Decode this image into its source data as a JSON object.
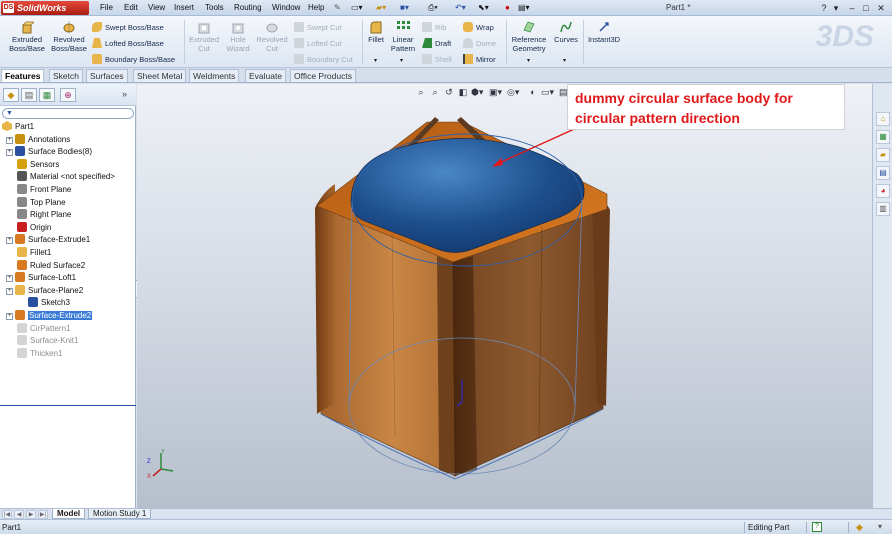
{
  "app": {
    "name": "SolidWorks",
    "doc_title": "Part1 *"
  },
  "menu": [
    "File",
    "Edit",
    "View",
    "Insert",
    "Tools",
    "Routing",
    "Window",
    "Help"
  ],
  "ribbon": {
    "extruded_boss": "Extruded Boss/Base",
    "revolved_boss": "Revolved Boss/Base",
    "swept_boss": "Swept Boss/Base",
    "lofted_boss": "Lofted Boss/Base",
    "boundary_boss": "Boundary Boss/Base",
    "extruded_cut": "Extruded Cut",
    "hole_wizard": "Hole Wizard",
    "revolved_cut": "Revolved Cut",
    "swept_cut": "Swept Cut",
    "lofted_cut": "Lofted Cut",
    "boundary_cut": "Boundary Cut",
    "fillet": "Fillet",
    "linear_pattern": "Linear Pattern",
    "rib": "Rib",
    "draft": "Draft",
    "shell": "Shell",
    "wrap": "Wrap",
    "dome": "Dome",
    "mirror": "Mirror",
    "reference_geometry": "Reference Geometry",
    "curves": "Curves",
    "instant3d": "Instant3D"
  },
  "tabs": [
    "Features",
    "Sketch",
    "Surfaces",
    "Sheet Metal",
    "Weldments",
    "Evaluate",
    "Office Products"
  ],
  "tree": {
    "root": "Part1",
    "items": [
      {
        "label": "Annotations",
        "expandable": true,
        "state": "normal",
        "icon": "annotations-icon"
      },
      {
        "label": "Surface Bodies(8)",
        "expandable": true,
        "state": "normal",
        "icon": "surface-bodies-icon"
      },
      {
        "label": "Sensors",
        "expandable": false,
        "state": "normal",
        "icon": "sensors-icon"
      },
      {
        "label": "Material <not specified>",
        "expandable": false,
        "state": "normal",
        "icon": "material-icon"
      },
      {
        "label": "Front Plane",
        "expandable": false,
        "state": "normal",
        "icon": "plane-icon"
      },
      {
        "label": "Top Plane",
        "expandable": false,
        "state": "normal",
        "icon": "plane-icon"
      },
      {
        "label": "Right Plane",
        "expandable": false,
        "state": "normal",
        "icon": "plane-icon"
      },
      {
        "label": "Origin",
        "expandable": false,
        "state": "normal",
        "icon": "origin-icon"
      },
      {
        "label": "Surface-Extrude1",
        "expandable": true,
        "state": "normal",
        "icon": "surface-extrude-icon"
      },
      {
        "label": "Fillet1",
        "expandable": false,
        "state": "normal",
        "icon": "fillet-icon"
      },
      {
        "label": "Ruled Surface2",
        "expandable": false,
        "state": "normal",
        "icon": "ruled-surface-icon"
      },
      {
        "label": "Surface-Loft1",
        "expandable": true,
        "state": "normal",
        "icon": "surface-loft-icon"
      },
      {
        "label": "Surface-Plane2",
        "expandable": true,
        "state": "normal",
        "icon": "surface-plane-icon"
      },
      {
        "label": "Sketch3",
        "expandable": false,
        "state": "child",
        "icon": "sketch-icon"
      },
      {
        "label": "Surface-Extrude2",
        "expandable": true,
        "state": "selected",
        "icon": "surface-extrude-icon"
      },
      {
        "label": "CirPattern1",
        "expandable": false,
        "state": "suppressed",
        "icon": "circular-pattern-icon"
      },
      {
        "label": "Surface-Knit1",
        "expandable": false,
        "state": "suppressed",
        "icon": "surface-knit-icon"
      },
      {
        "label": "Thicken1",
        "expandable": false,
        "state": "suppressed",
        "icon": "thicken-icon"
      }
    ]
  },
  "annotation": {
    "line1": "dummy circular surface body for",
    "line2": "circular pattern direction",
    "color": "#e0191a"
  },
  "bottom_tabs": [
    "Model",
    "Motion Study 1"
  ],
  "status": {
    "left": "Part1",
    "mode": "Editing Part"
  },
  "colors": {
    "part_body": "#c47a3c",
    "inner_surface": "#1c4f8e",
    "selection": "#3a7bd5"
  }
}
